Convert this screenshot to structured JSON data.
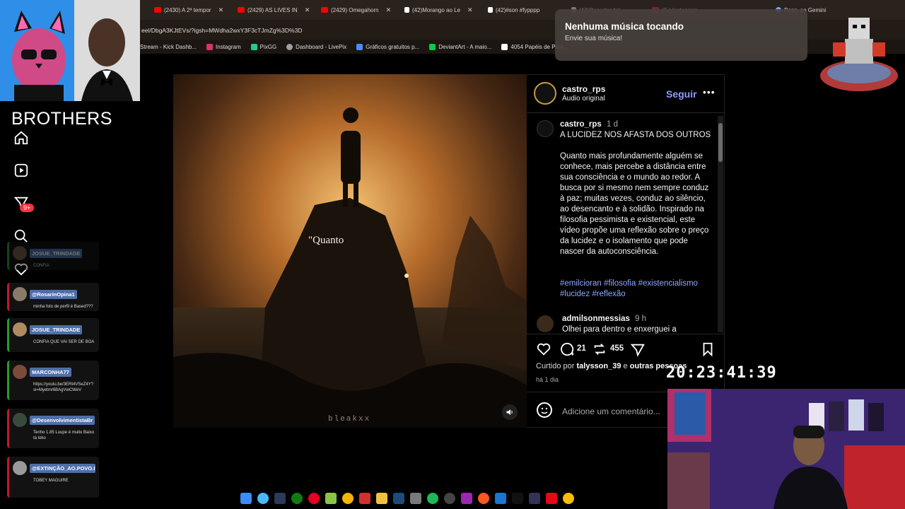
{
  "browser": {
    "tabs": [
      {
        "label": "(2430) A 2ª tempor",
        "color": "#ff0000"
      },
      {
        "label": "(2429) AS LIVES IN",
        "color": "#ff0000"
      },
      {
        "label": "(2429) Omegahorn",
        "color": "#ff0000"
      },
      {
        "label": "(42)Morango ao Le",
        "color": "#ffffff"
      },
      {
        "label": "(42)#son #fypppp",
        "color": "#ffffff"
      },
      {
        "label": "(42)Reportando!",
        "color": "#ffffff"
      },
      {
        "label": "(2•) Instagram",
        "color": "#e1306c"
      }
    ],
    "gemini_label": "Pesq. ao Gemini",
    "url": "eel/DbgA3KJtEVs/?igsh=MWdha2wxY3F3cTJmZg%3D%3D",
    "bookmarks": [
      {
        "label": "Stream - Kick Dashb...",
        "color": "#53fc18"
      },
      {
        "label": "Instagram",
        "color": "#e1306c"
      },
      {
        "label": "PixGG",
        "color": "#20c997"
      },
      {
        "label": "Dashboard - LivePix",
        "color": "#9aa0a6"
      },
      {
        "label": "Gráficos gratuitos p...",
        "color": "#4a8cff"
      },
      {
        "label": "DeviantArt - A maio...",
        "color": "#05cc47"
      },
      {
        "label": "4054 Papéis de Pare...",
        "color": "#ffffff"
      }
    ]
  },
  "overlay": {
    "title": "BROTHERS",
    "notif_count": "9+",
    "chat": [
      {
        "user": "JOSUE_TRINDADE",
        "msg": "CONFIA",
        "style": "green"
      },
      {
        "user": "@RosarinOpina1",
        "msg": "minha foto de perfil é Based???",
        "style": "red"
      },
      {
        "user": "JOSUE_TRINDADE",
        "msg": "CONFIA QUE VAI SER DE BOA",
        "style": "green"
      },
      {
        "user": "MARCONHA77",
        "msg": "https://youtu.be/3ERt4VSeZ4Y?si=Myetmr6BAgVwCWeV",
        "style": "green"
      },
      {
        "user": "@DesenvolvimentistaBr",
        "msg": "Tenho 1.85 Luupe é muito Baixo tá loko",
        "style": "red"
      },
      {
        "user": "@EXTINÇÃO_AO.POVO.I",
        "msg": "TOBEY MAGUIRE",
        "style": "red"
      }
    ],
    "clock": "20:23:41:39"
  },
  "notification": {
    "title": "Nenhuma música tocando",
    "subtitle": "Envie sua música!"
  },
  "post": {
    "caption_overlay": "\"Quanto",
    "watermark": "bleakxx",
    "username": "castro_rps",
    "audio": "Áudio original",
    "follow": "Seguir",
    "caption_user": "castro_rps",
    "caption_time": "1 d",
    "caption_title": "A LUCIDEZ NOS AFASTA DOS OUTROS",
    "caption_body": "Quanto mais profundamente alguém se conhece, mais percebe a distância entre sua consciência e o mundo ao redor. A busca por si mesmo nem sempre conduz à paz; muitas vezes, conduz ao silêncio, ao desencanto e à solidão. Inspirado na filosofia pessimista e existencial, este vídeo propõe uma reflexão sobre o preço da lucidez e o isolamento que pode nascer da autoconsciência.",
    "hashtags": "#emilcioran #filosofia #existencialismo #lucidez #reflexão",
    "comment_user": "admilsonmessias",
    "comment_time": "9 h",
    "comment_text": "Olhei para dentro e enxerguei a",
    "comments_count": "21",
    "reposts_count": "455",
    "liked_prefix": "Curtido por",
    "liked_user": "talysson_39",
    "liked_and": "e",
    "liked_others": "outras pessoas",
    "time_ago": "há 1 dia",
    "comment_placeholder": "Adicione um comentário..."
  }
}
